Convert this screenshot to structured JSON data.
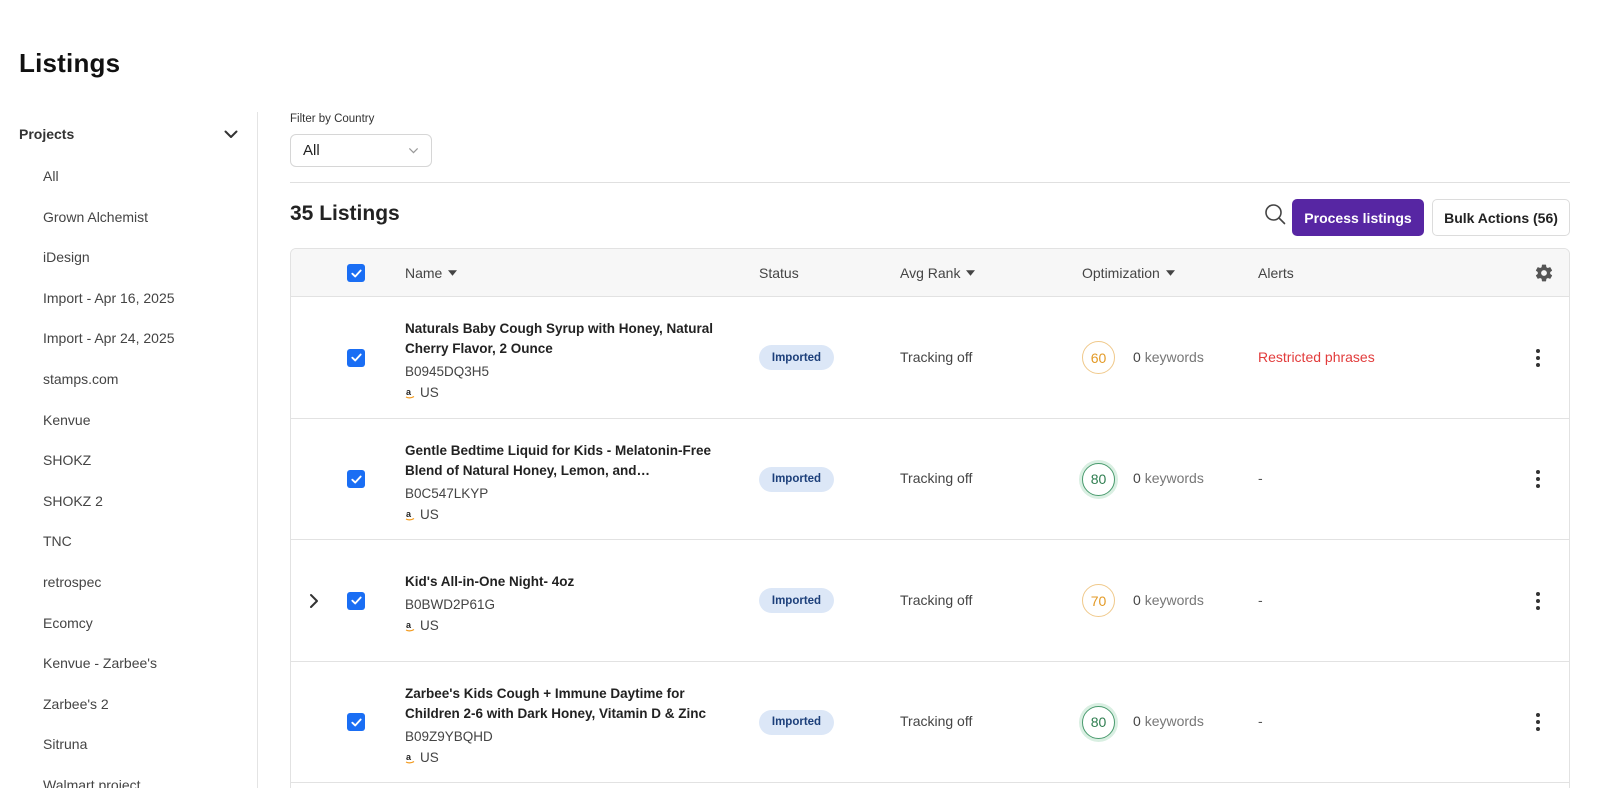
{
  "page": {
    "title": "Listings"
  },
  "sidebar": {
    "header": "Projects",
    "items": [
      "All",
      "Grown Alchemist",
      "iDesign",
      "Import - Apr 16, 2025",
      "Import - Apr 24, 2025",
      "stamps.com",
      "Kenvue",
      "SHOKZ",
      "SHOKZ 2",
      "TNC",
      "retrospec",
      "Ecomcy",
      "Kenvue - Zarbee's",
      "Zarbee's 2",
      "Sitruna",
      "Walmart project"
    ]
  },
  "filter": {
    "label": "Filter by Country",
    "value": "All"
  },
  "toolbar": {
    "count": "35 Listings",
    "process_label": "Process listings",
    "bulk_label": "Bulk Actions (56)"
  },
  "table": {
    "headers": {
      "name": "Name",
      "status": "Status",
      "avg_rank": "Avg Rank",
      "optimization": "Optimization",
      "alerts": "Alerts"
    },
    "rows": [
      {
        "title": "Naturals Baby Cough Syrup with Honey, Natural Cherry Flavor, 2 Ounce",
        "asin": "B0945DQ3H5",
        "market": "US",
        "status": "Imported",
        "tracking": "Tracking off",
        "score": "60",
        "score_tone": "amber",
        "keywords_count": "0",
        "keywords_label": "keywords",
        "alert": "Restricted phrases",
        "alert_tone": "red",
        "expandable": false,
        "checked": true
      },
      {
        "title": "Gentle Bedtime Liquid for Kids - Melatonin-Free Blend of Natural Honey, Lemon, and Chamomile...",
        "asin": "B0C547LKYP",
        "market": "US",
        "status": "Imported",
        "tracking": "Tracking off",
        "score": "80",
        "score_tone": "green",
        "keywords_count": "0",
        "keywords_label": "keywords",
        "alert": "-",
        "alert_tone": "plain",
        "expandable": false,
        "checked": true
      },
      {
        "title": "Kid's All-in-One Night- 4oz",
        "asin": "B0BWD2P61G",
        "market": "US",
        "status": "Imported",
        "tracking": "Tracking off",
        "score": "70",
        "score_tone": "amber",
        "keywords_count": "0",
        "keywords_label": "keywords",
        "alert": "-",
        "alert_tone": "plain",
        "expandable": true,
        "checked": true
      },
      {
        "title": "Zarbee's Kids Cough + Immune Daytime for Children 2-6 with Dark Honey, Vitamin D & Zinc",
        "asin": "B09Z9YBQHD",
        "market": "US",
        "status": "Imported",
        "tracking": "Tracking off",
        "score": "80",
        "score_tone": "green",
        "keywords_count": "0",
        "keywords_label": "keywords",
        "alert": "-",
        "alert_tone": "plain",
        "expandable": false,
        "checked": true
      }
    ]
  },
  "colors": {
    "primary": "#5726a3",
    "checkbox": "#1a6ef4",
    "alert_red": "#e23c3c",
    "badge_bg": "#dce7f7"
  }
}
